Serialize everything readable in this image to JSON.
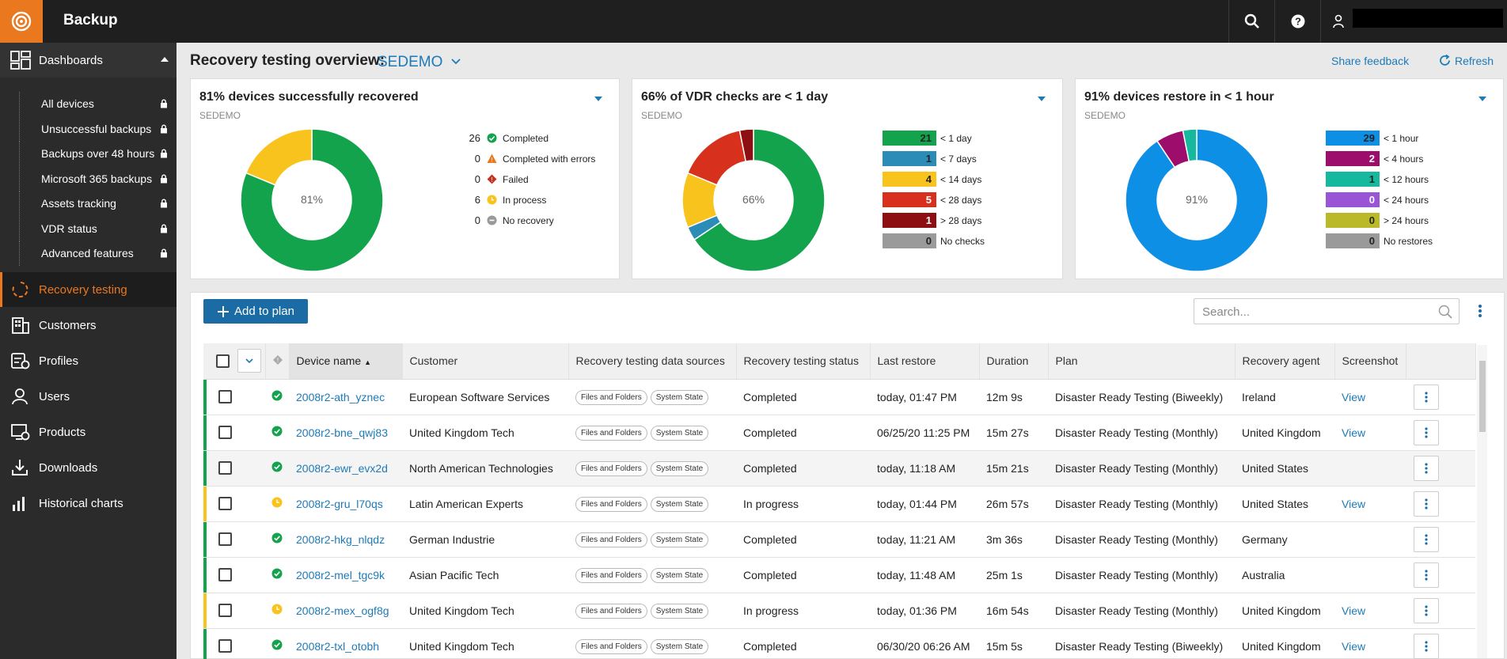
{
  "app": {
    "title": "Backup"
  },
  "sidebar": {
    "dashboards_label": "Dashboards",
    "sub_items": [
      {
        "label": "All devices"
      },
      {
        "label": "Unsuccessful backups"
      },
      {
        "label": "Backups over 48 hours"
      },
      {
        "label": "Microsoft 365 backups"
      },
      {
        "label": "Assets tracking"
      },
      {
        "label": "VDR status"
      },
      {
        "label": "Advanced features"
      }
    ],
    "sections": [
      {
        "label": "Recovery testing",
        "icon": "recovery-testing-icon"
      },
      {
        "label": "Customers",
        "icon": "customers-icon"
      },
      {
        "label": "Profiles",
        "icon": "profiles-icon"
      },
      {
        "label": "Users",
        "icon": "users-icon"
      },
      {
        "label": "Products",
        "icon": "products-icon"
      },
      {
        "label": "Downloads",
        "icon": "downloads-icon"
      },
      {
        "label": "Historical charts",
        "icon": "historical-charts-icon"
      }
    ]
  },
  "header": {
    "title": "Recovery testing overview:",
    "tenant": "SEDEMO",
    "share_feedback": "Share feedback",
    "refresh": "Refresh"
  },
  "cards": [
    {
      "title": "81% devices successfully recovered",
      "subtitle": "SEDEMO",
      "center": "81%",
      "legend": [
        {
          "count": "26",
          "label": "Completed",
          "color": "#13a34d",
          "icon": "completed-icon"
        },
        {
          "count": "0",
          "label": "Completed with errors",
          "color": "#e9781f",
          "icon": "warning-icon"
        },
        {
          "count": "0",
          "label": "Failed",
          "color": "#c8321e",
          "icon": "failed-icon"
        },
        {
          "count": "6",
          "label": "In process",
          "color": "#f7c31c",
          "icon": "in-process-icon"
        },
        {
          "count": "0",
          "label": "No recovery",
          "color": "#999999",
          "icon": "no-recovery-icon"
        }
      ]
    },
    {
      "title": "66% of VDR checks are < 1 day",
      "subtitle": "SEDEMO",
      "center": "66%",
      "legend": [
        {
          "count": "21",
          "label": "< 1 day",
          "color": "#13a34d",
          "text": "#222"
        },
        {
          "count": "1",
          "label": "< 7 days",
          "color": "#2b8cb7",
          "text": "#222"
        },
        {
          "count": "4",
          "label": "< 14 days",
          "color": "#f7c31c",
          "text": "#222"
        },
        {
          "count": "5",
          "label": "< 28 days",
          "color": "#d7311e",
          "text": "#ffffff"
        },
        {
          "count": "1",
          "label": "> 28 days",
          "color": "#8d0f12",
          "text": "#ffffff"
        },
        {
          "count": "0",
          "label": "No checks",
          "color": "#9a9a9a",
          "text": "#222"
        }
      ]
    },
    {
      "title": "91% devices restore in < 1 hour",
      "subtitle": "SEDEMO",
      "center": "91%",
      "legend": [
        {
          "count": "29",
          "label": "< 1 hour",
          "color": "#0e8fe6",
          "text": "#222"
        },
        {
          "count": "2",
          "label": "< 4 hours",
          "color": "#9c0d6c",
          "text": "#ffffff"
        },
        {
          "count": "1",
          "label": "< 12 hours",
          "color": "#16b89e",
          "text": "#222"
        },
        {
          "count": "0",
          "label": "< 24 hours",
          "color": "#9a54d6",
          "text": "#ffffff"
        },
        {
          "count": "0",
          "label": "> 24 hours",
          "color": "#b9b92a",
          "text": "#222"
        },
        {
          "count": "0",
          "label": "No restores",
          "color": "#9a9a9a",
          "text": "#222"
        }
      ]
    }
  ],
  "toolbar": {
    "add_label": "Add to plan",
    "search_placeholder": "Search..."
  },
  "table": {
    "columns": [
      "Device name",
      "Customer",
      "Recovery testing data sources",
      "Recovery testing status",
      "Last restore",
      "Duration",
      "Plan",
      "Recovery agent",
      "Screenshot"
    ],
    "rows": [
      {
        "status": "completed",
        "device": "2008r2-ath_yznec",
        "customer": "European Software Services",
        "sources": [
          "Files and Folders",
          "System State"
        ],
        "rt_status": "Completed",
        "last_restore": "today, 01:47 PM",
        "duration": "12m 9s",
        "plan": "Disaster Ready Testing (Biweekly)",
        "agent": "Ireland",
        "screenshot": "View"
      },
      {
        "status": "completed",
        "device": "2008r2-bne_qwj83",
        "customer": "United Kingdom Tech",
        "sources": [
          "Files and Folders",
          "System State"
        ],
        "rt_status": "Completed",
        "last_restore": "06/25/20 11:25 PM",
        "duration": "15m 27s",
        "plan": "Disaster Ready Testing (Monthly)",
        "agent": "United Kingdom",
        "screenshot": "View"
      },
      {
        "status": "completed",
        "device": "2008r2-ewr_evx2d",
        "customer": "North American Technologies",
        "sources": [
          "Files and Folders",
          "System State"
        ],
        "rt_status": "Completed",
        "last_restore": "today, 11:18 AM",
        "duration": "15m 21s",
        "plan": "Disaster Ready Testing (Monthly)",
        "agent": "United States",
        "screenshot": ""
      },
      {
        "status": "progress",
        "device": "2008r2-gru_l70qs",
        "customer": "Latin American Experts",
        "sources": [
          "Files and Folders",
          "System State"
        ],
        "rt_status": "In progress",
        "last_restore": "today, 01:44 PM",
        "duration": "26m 57s",
        "plan": "Disaster Ready Testing (Monthly)",
        "agent": "United States",
        "screenshot": "View"
      },
      {
        "status": "completed",
        "device": "2008r2-hkg_nlqdz",
        "customer": "German Industrie",
        "sources": [
          "Files and Folders",
          "System State"
        ],
        "rt_status": "Completed",
        "last_restore": "today, 11:21 AM",
        "duration": "3m 36s",
        "plan": "Disaster Ready Testing (Monthly)",
        "agent": "Germany",
        "screenshot": ""
      },
      {
        "status": "completed",
        "device": "2008r2-mel_tgc9k",
        "customer": "Asian Pacific Tech",
        "sources": [
          "Files and Folders",
          "System State"
        ],
        "rt_status": "Completed",
        "last_restore": "today, 11:48 AM",
        "duration": "25m 1s",
        "plan": "Disaster Ready Testing (Monthly)",
        "agent": "Australia",
        "screenshot": ""
      },
      {
        "status": "progress",
        "device": "2008r2-mex_ogf8g",
        "customer": "United Kingdom Tech",
        "sources": [
          "Files and Folders",
          "System State"
        ],
        "rt_status": "In progress",
        "last_restore": "today, 01:36 PM",
        "duration": "16m 54s",
        "plan": "Disaster Ready Testing (Monthly)",
        "agent": "United Kingdom",
        "screenshot": "View"
      },
      {
        "status": "completed",
        "device": "2008r2-txl_otobh",
        "customer": "United Kingdom Tech",
        "sources": [
          "Files and Folders",
          "System State"
        ],
        "rt_status": "Completed",
        "last_restore": "06/30/20 06:26 AM",
        "duration": "15m 5s",
        "plan": "Disaster Ready Testing (Biweekly)",
        "agent": "United Kingdom",
        "screenshot": "View"
      }
    ]
  },
  "chart_data": [
    {
      "type": "pie",
      "title": "81% devices successfully recovered",
      "categories": [
        "Completed",
        "Completed with errors",
        "Failed",
        "In process",
        "No recovery"
      ],
      "values": [
        26,
        0,
        0,
        6,
        0
      ],
      "colors": [
        "#13a34d",
        "#e9781f",
        "#c8321e",
        "#f7c31c",
        "#999999"
      ]
    },
    {
      "type": "pie",
      "title": "66% of VDR checks are < 1 day",
      "categories": [
        "< 1 day",
        "< 7 days",
        "< 14 days",
        "< 28 days",
        "> 28 days",
        "No checks"
      ],
      "values": [
        21,
        1,
        4,
        5,
        1,
        0
      ],
      "colors": [
        "#13a34d",
        "#2b8cb7",
        "#f7c31c",
        "#d7311e",
        "#8d0f12",
        "#9a9a9a"
      ]
    },
    {
      "type": "pie",
      "title": "91% devices restore in < 1 hour",
      "categories": [
        "< 1 hour",
        "< 4 hours",
        "< 12 hours",
        "< 24 hours",
        "> 24 hours",
        "No restores"
      ],
      "values": [
        29,
        2,
        1,
        0,
        0,
        0
      ],
      "colors": [
        "#0e8fe6",
        "#9c0d6c",
        "#16b89e",
        "#9a54d6",
        "#b9b92a",
        "#9a9a9a"
      ]
    }
  ]
}
